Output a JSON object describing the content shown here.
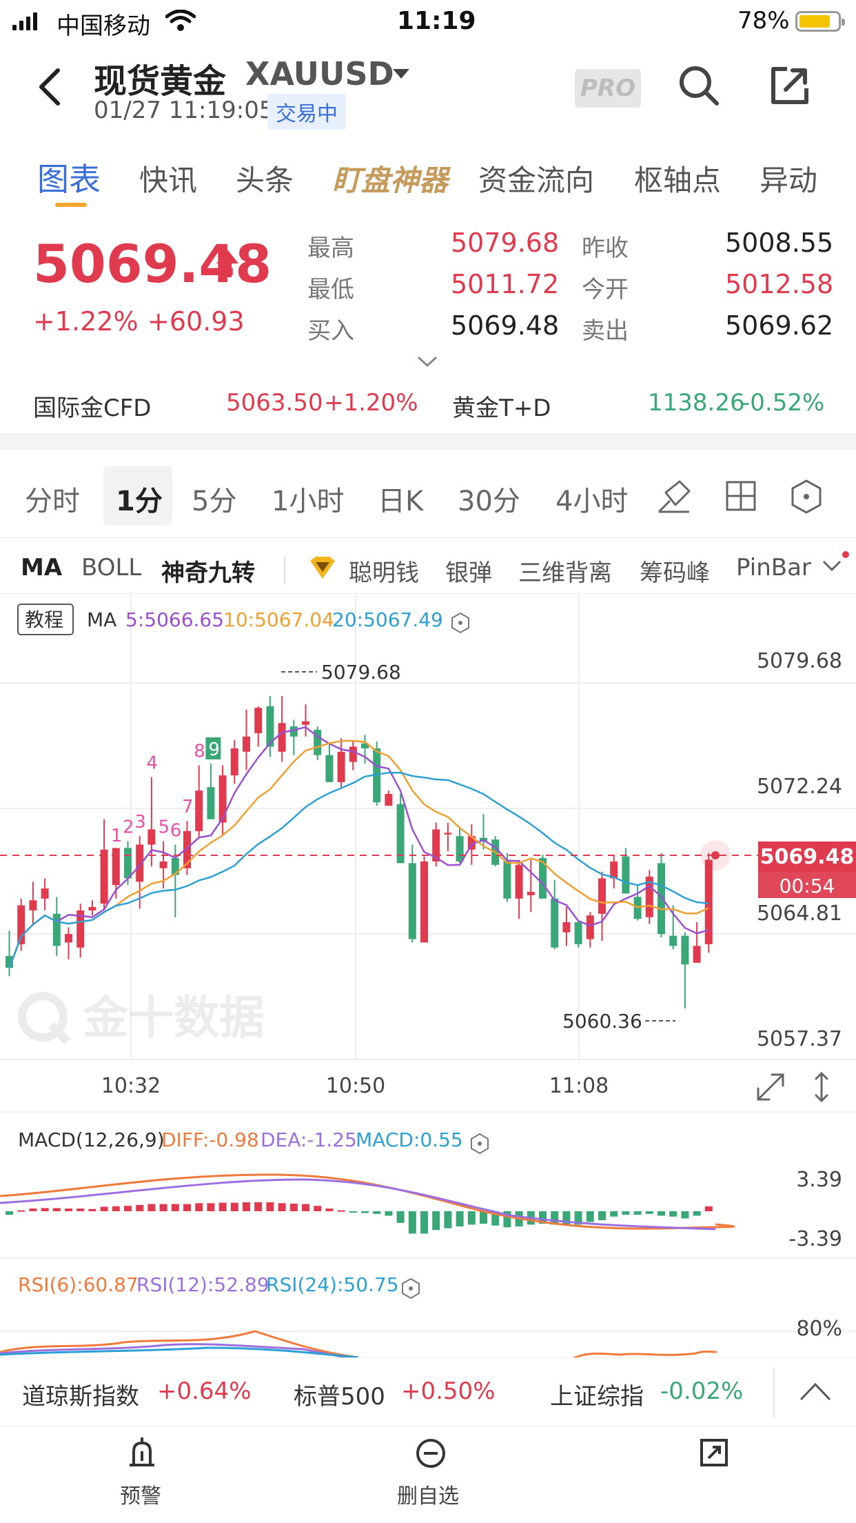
{
  "status_bar": {
    "carrier": "中国移动",
    "time": "11:19",
    "battery": "78%"
  },
  "header": {
    "title": "现货黄金",
    "symbol": "XAUUSD",
    "datetime": "01/27 11:19:05",
    "trade_state": "交易中",
    "pro_label": "PRO"
  },
  "tabs": [
    "图表",
    "快讯",
    "头条",
    "盯盘神器",
    "资金流向",
    "枢轴点",
    "异动"
  ],
  "quote": {
    "price": "5069.48",
    "change_pct": "+1.22%",
    "change_abs": "+60.93",
    "stats": [
      {
        "label": "最高",
        "value": "5079.68"
      },
      {
        "label": "最低",
        "value": "5011.72"
      },
      {
        "label": "买入",
        "value": "5069.48"
      },
      {
        "label": "昨收",
        "value": "5008.55"
      },
      {
        "label": "今开",
        "value": "5012.58"
      },
      {
        "label": "卖出",
        "value": "5069.62"
      }
    ],
    "related": [
      {
        "name": "国际金CFD",
        "price": "5063.50",
        "change": "+1.20%"
      },
      {
        "name": "黄金T+D",
        "price": "1138.26",
        "change": "-0.52%"
      }
    ]
  },
  "periods": [
    "分时",
    "1分",
    "5分",
    "1小时",
    "日K",
    "30分",
    "4小时"
  ],
  "indicators": {
    "left": [
      "MA",
      "BOLL",
      "神奇九转"
    ],
    "right": [
      "聪明钱",
      "银弹",
      "三维背离",
      "筹码峰",
      "PinBar"
    ]
  },
  "chart": {
    "tutorial": "教程",
    "ma_label": "MA",
    "ma5": "5:5066.65",
    "ma10": "10:5067.04",
    "ma20": "20:5067.49",
    "high_marker": "5079.68",
    "low_marker": "5060.36",
    "current_price": "5069.48",
    "countdown": "00:54",
    "watermark": "金十数据",
    "nine_counts": [
      "1",
      "2",
      "3",
      "4",
      "5",
      "6",
      "7",
      "8",
      "9"
    ],
    "macd_title": "MACD(12,26,9)",
    "diff": "DIFF:-0.98",
    "dea": "DEA:-1.25",
    "macd": "MACD:0.55",
    "macd_ticks": [
      "3.39",
      "-3.39"
    ],
    "rsi6": "RSI(6):60.87",
    "rsi12": "RSI(12):52.89",
    "rsi24": "RSI(24):50.75",
    "rsi_tick": "80%"
  },
  "chart_data": {
    "type": "candlestick",
    "y_ticks": [
      "5079.68",
      "5072.24",
      "5064.81",
      "5057.37"
    ],
    "ylim": [
      5057.37,
      5079.68
    ],
    "x_ticks": [
      "10:32",
      "10:50",
      "11:08"
    ],
    "candles": [
      [
        5063.5,
        5065.0,
        5062.3,
        5062.8
      ],
      [
        5064.2,
        5066.9,
        5063.8,
        5066.5
      ],
      [
        5066.2,
        5067.9,
        5065.3,
        5066.8
      ],
      [
        5066.9,
        5068.1,
        5066.2,
        5067.5
      ],
      [
        5066.0,
        5067.0,
        5063.5,
        5064.1
      ],
      [
        5064.3,
        5065.2,
        5063.3,
        5064.8
      ],
      [
        5064.0,
        5066.6,
        5063.4,
        5066.2
      ],
      [
        5066.2,
        5066.8,
        5065.9,
        5066.4
      ],
      [
        5066.6,
        5071.6,
        5066.2,
        5069.8
      ],
      [
        5067.7,
        5069.8,
        5066.9,
        5069.9
      ],
      [
        5069.9,
        5070.3,
        5067.7,
        5068.1
      ],
      [
        5067.9,
        5070.6,
        5066.3,
        5070.1
      ],
      [
        5070.1,
        5074.1,
        5068.8,
        5071.0
      ],
      [
        5068.7,
        5070.3,
        5067.5,
        5069.1
      ],
      [
        5069.3,
        5070.1,
        5065.8,
        5068.3
      ],
      [
        5068.7,
        5071.5,
        5068.3,
        5070.9
      ],
      [
        5070.9,
        5074.8,
        5070.5,
        5073.3
      ],
      [
        5073.5,
        5074.9,
        5071.6,
        5071.6
      ],
      [
        5071.4,
        5074.8,
        5070.6,
        5074.2
      ],
      [
        5074.2,
        5076.3,
        5073.7,
        5075.8
      ],
      [
        5075.6,
        5078.1,
        5074.5,
        5076.5
      ],
      [
        5076.7,
        5078.3,
        5075.9,
        5078.2
      ],
      [
        5078.3,
        5078.9,
        5075.3,
        5075.9
      ],
      [
        5075.6,
        5078.9,
        5075.0,
        5077.3
      ],
      [
        5077.1,
        5077.5,
        5075.4,
        5076.5
      ],
      [
        5077.2,
        5078.4,
        5076.5,
        5077.4
      ],
      [
        5076.9,
        5077.1,
        5075.1,
        5075.4
      ],
      [
        5075.4,
        5076.1,
        5073.8,
        5073.8
      ],
      [
        5073.8,
        5076.4,
        5073.5,
        5075.6
      ],
      [
        5075.0,
        5076.2,
        5074.5,
        5075.9
      ],
      [
        5076.1,
        5076.6,
        5074.9,
        5075.8
      ],
      [
        5075.8,
        5076.2,
        5072.4,
        5072.6
      ],
      [
        5072.4,
        5073.3,
        5072.4,
        5073.1
      ],
      [
        5072.5,
        5073.1,
        5069.0,
        5069.0
      ],
      [
        5069.0,
        5070.1,
        5064.3,
        5064.5
      ],
      [
        5064.3,
        5069.4,
        5064.4,
        5069.1
      ],
      [
        5069.1,
        5071.4,
        5068.8,
        5071.0
      ],
      [
        5070.7,
        5071.4,
        5069.7,
        5070.8
      ],
      [
        5070.6,
        5071.1,
        5069.0,
        5069.1
      ],
      [
        5069.8,
        5071.3,
        5068.9,
        5070.6
      ],
      [
        5070.5,
        5071.9,
        5069.8,
        5070.3
      ],
      [
        5070.4,
        5070.6,
        5068.8,
        5068.9
      ],
      [
        5069.1,
        5069.6,
        5066.7,
        5066.9
      ],
      [
        5066.9,
        5069.2,
        5065.7,
        5068.9
      ],
      [
        5067.1,
        5069.2,
        5066.1,
        5067.3
      ],
      [
        5069.3,
        5069.5,
        5066.9,
        5066.9
      ],
      [
        5066.9,
        5068.0,
        5063.9,
        5064.0
      ],
      [
        5064.9,
        5066.4,
        5064.1,
        5065.5
      ],
      [
        5065.5,
        5065.6,
        5064.0,
        5064.2
      ],
      [
        5064.5,
        5066.1,
        5064.0,
        5065.9
      ],
      [
        5066.0,
        5068.5,
        5064.4,
        5068.1
      ],
      [
        5068.1,
        5069.5,
        5067.5,
        5069.1
      ],
      [
        5069.4,
        5069.9,
        5067.2,
        5067.2
      ],
      [
        5067.0,
        5067.7,
        5065.6,
        5065.7
      ],
      [
        5065.8,
        5068.6,
        5065.4,
        5068.2
      ],
      [
        5069.0,
        5069.6,
        5064.6,
        5064.8
      ],
      [
        5064.7,
        5066.5,
        5063.9,
        5064.1
      ],
      [
        5064.7,
        5064.9,
        5060.4,
        5063.0
      ],
      [
        5063.1,
        5065.5,
        5063.1,
        5064.1
      ],
      [
        5064.2,
        5069.6,
        5063.7,
        5069.2
      ]
    ],
    "macd_hist": [
      -0.4,
      0.1,
      0.3,
      0.35,
      0.35,
      0.3,
      0.3,
      0.25,
      0.5,
      0.55,
      0.6,
      0.7,
      0.8,
      0.8,
      0.8,
      0.8,
      0.9,
      0.9,
      0.95,
      0.95,
      1.0,
      1.0,
      1.0,
      0.9,
      0.85,
      0.8,
      0.6,
      0.3,
      0.1,
      -0.1,
      -0.2,
      -0.3,
      -0.5,
      -1.3,
      -2.5,
      -2.5,
      -2.1,
      -1.9,
      -1.7,
      -1.5,
      -1.4,
      -1.6,
      -1.8,
      -1.7,
      -1.5,
      -1.4,
      -1.5,
      -1.6,
      -1.5,
      -1.2,
      -1.0,
      -0.6,
      -0.4,
      -0.4,
      -0.3,
      -0.5,
      -0.6,
      -0.8,
      -0.5,
      0.55
    ],
    "macd_ylim": [
      -3.39,
      3.39
    ]
  }
}
